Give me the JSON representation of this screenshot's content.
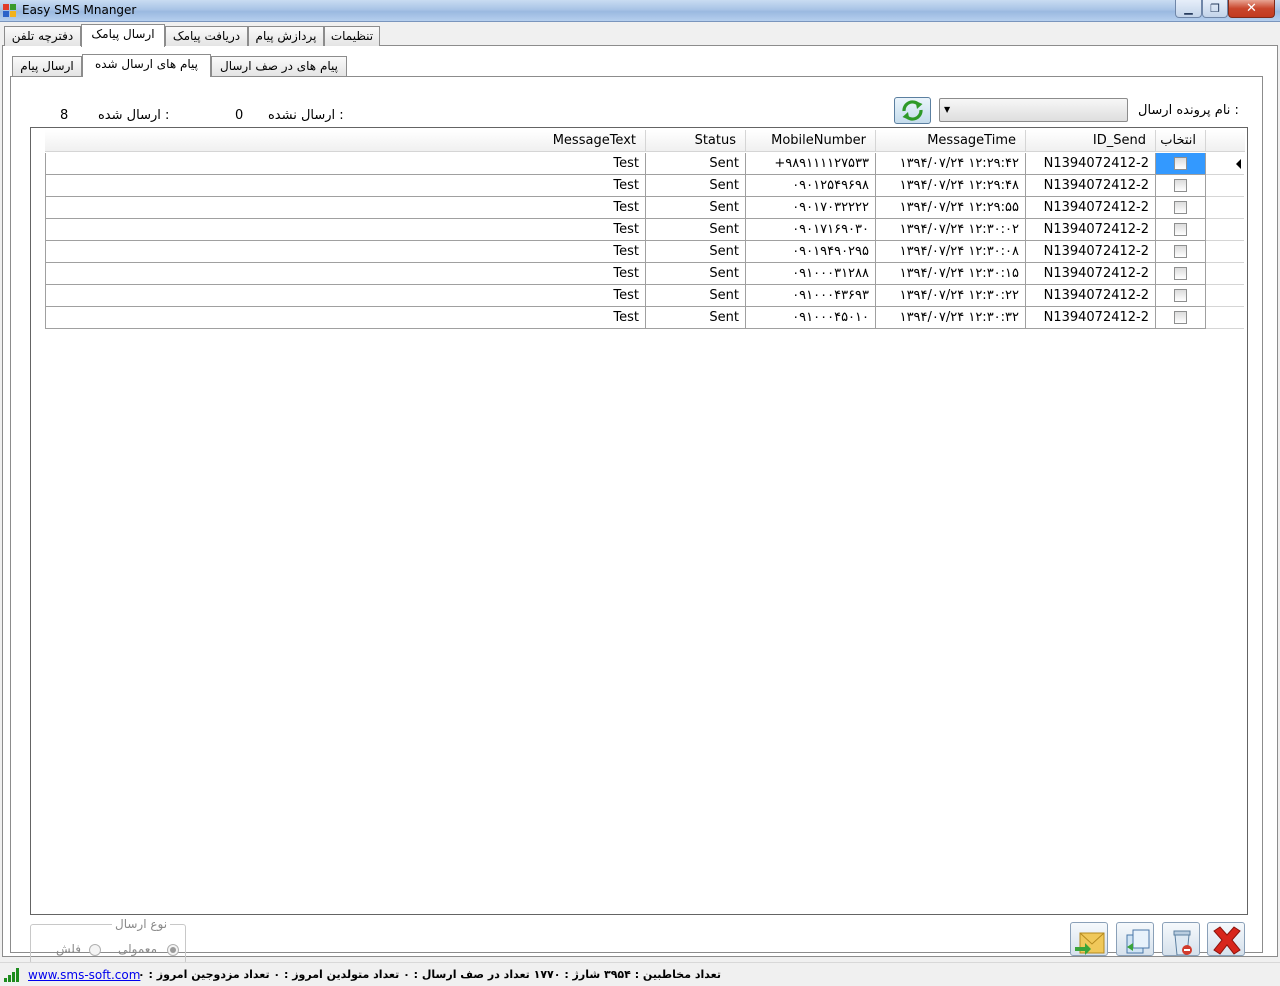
{
  "window": {
    "title": "Easy SMS Mnanger"
  },
  "top_tabs": [
    {
      "label": "دفترچه تلفن"
    },
    {
      "label": "ارسال پیامک"
    },
    {
      "label": "دریافت پیامک"
    },
    {
      "label": "پردازش پیام"
    },
    {
      "label": "تنظیمات"
    }
  ],
  "sub_tabs": [
    {
      "label": "ارسال پیام"
    },
    {
      "label": "پیام های ارسال شده"
    },
    {
      "label": "پیام های در صف ارسال"
    }
  ],
  "file_label": "نام پرونده ارسال :",
  "counters": {
    "sent_label": "ارسال شده :",
    "sent_value": "8",
    "unsent_label": "ارسال نشده :",
    "unsent_value": "0"
  },
  "grid": {
    "headers": {
      "select": "انتخاب",
      "id": "ID_Send",
      "time": "MessageTime",
      "mobile": "MobileNumber",
      "status": "Status",
      "text": "MessageText"
    },
    "rows": [
      {
        "id": "N1394072412-2",
        "time": "۱۳۹۴/۰۷/۲۴ ۱۲:۲۹:۴۲",
        "mobile": "+۹۸۹۱۱۱۱۲۷۵۳۳",
        "status": "Sent",
        "text": "Test"
      },
      {
        "id": "N1394072412-2",
        "time": "۱۳۹۴/۰۷/۲۴ ۱۲:۲۹:۴۸",
        "mobile": "۰۹۰۱۲۵۴۹۶۹۸",
        "status": "Sent",
        "text": "Test"
      },
      {
        "id": "N1394072412-2",
        "time": "۱۳۹۴/۰۷/۲۴ ۱۲:۲۹:۵۵",
        "mobile": "۰۹۰۱۷۰۳۲۲۲۲",
        "status": "Sent",
        "text": "Test"
      },
      {
        "id": "N1394072412-2",
        "time": "۱۳۹۴/۰۷/۲۴ ۱۲:۳۰:۰۲",
        "mobile": "۰۹۰۱۷۱۶۹۰۳۰",
        "status": "Sent",
        "text": "Test"
      },
      {
        "id": "N1394072412-2",
        "time": "۱۳۹۴/۰۷/۲۴ ۱۲:۳۰:۰۸",
        "mobile": "۰۹۰۱۹۴۹۰۲۹۵",
        "status": "Sent",
        "text": "Test"
      },
      {
        "id": "N1394072412-2",
        "time": "۱۳۹۴/۰۷/۲۴ ۱۲:۳۰:۱۵",
        "mobile": "۰۹۱۰۰۰۳۱۲۸۸",
        "status": "Sent",
        "text": "Test"
      },
      {
        "id": "N1394072412-2",
        "time": "۱۳۹۴/۰۷/۲۴ ۱۲:۳۰:۲۲",
        "mobile": "۰۹۱۰۰۰۴۳۶۹۳",
        "status": "Sent",
        "text": "Test"
      },
      {
        "id": "N1394072412-2",
        "time": "۱۳۹۴/۰۷/۲۴ ۱۲:۳۰:۳۲",
        "mobile": "۰۹۱۰۰۰۴۵۰۱۰",
        "status": "Sent",
        "text": "Test"
      }
    ]
  },
  "send_type": {
    "title": "نوع ارسال",
    "normal_label": "معمولی",
    "flash_label": "فلش"
  },
  "statusbar": {
    "link": "www.sms-soft.com",
    "text": "تعداد مخاطبین : ۳۹۵۴  شارژ : ۱۷۷۰  تعداد در صف ارسال : ۰  تعداد متولدین امروز : ۰  تعداد مزدوجین امروز : ۰"
  },
  "colors": {
    "selection": "#3399ff",
    "link": "#0000ee",
    "close": "#c9462c"
  }
}
